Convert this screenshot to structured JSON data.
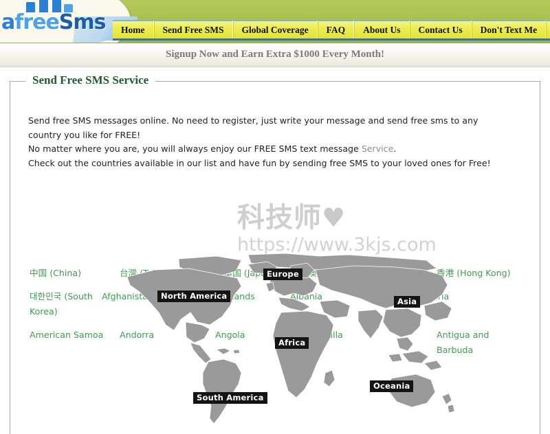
{
  "site": {
    "logo_text_a": "a",
    "logo_text_free": "free",
    "logo_text_sms": "Sms",
    "logo_alt": "afreeSms"
  },
  "nav": {
    "items": [
      {
        "label": "Home",
        "name": "nav-home"
      },
      {
        "label": "Send Free SMS",
        "name": "nav-send-free-sms"
      },
      {
        "label": "Global Coverage",
        "name": "nav-global-coverage"
      },
      {
        "label": "FAQ",
        "name": "nav-faq"
      },
      {
        "label": "About Us",
        "name": "nav-about-us"
      },
      {
        "label": "Contact Us",
        "name": "nav-contact-us"
      },
      {
        "label": "Don't Text Me",
        "name": "nav-dont-text-me"
      }
    ]
  },
  "banner": {
    "text": "Signup Now and Earn Extra $1000 Every Month!"
  },
  "main": {
    "legend": "Send Free SMS Service",
    "intro": {
      "line1": "Send free SMS messages online. No need to register, just write your message and send free sms to any country you like for FREE!",
      "line2_a": "No matter where you are, you will always enjoy our FREE SMS text message ",
      "line2_b": "Service",
      "line2_c": ".",
      "line3": "Check out the countries available in our list and have fun by sending free SMS to your loved ones for Free!"
    }
  },
  "watermark": {
    "cn": "科技师",
    "heart": "♥",
    "url": "https://www.3kjs.com"
  },
  "map": {
    "labels": {
      "north_america": "North America",
      "europe": "Europe",
      "asia": "Asia",
      "africa": "Africa",
      "south_america": "South America",
      "oceania": "Oceania"
    }
  },
  "countries": {
    "rows": [
      [
        "中国 (China)",
        "台灣 (Taiwan)",
        "日本国 (Japan)",
        "澳門 (Macau)",
        "香港 (Hong Kong)"
      ],
      [
        "대한민국 (South Korea)",
        "Afghanistan",
        "Aland Islands",
        "Albania",
        "Algeria"
      ],
      [
        "American Samoa",
        "Andorra",
        "Angola",
        "Anguilla",
        "Antigua and Barbuda"
      ]
    ]
  },
  "colors": {
    "header_green": "#a6c04a",
    "nav_yellow": "#eded52",
    "logo_blue": "#2b7fd4",
    "legend_green": "#1d5c2e",
    "link_green": "#3f9d4f",
    "map_land": "#9a9a9a",
    "label_bg": "#141414"
  }
}
